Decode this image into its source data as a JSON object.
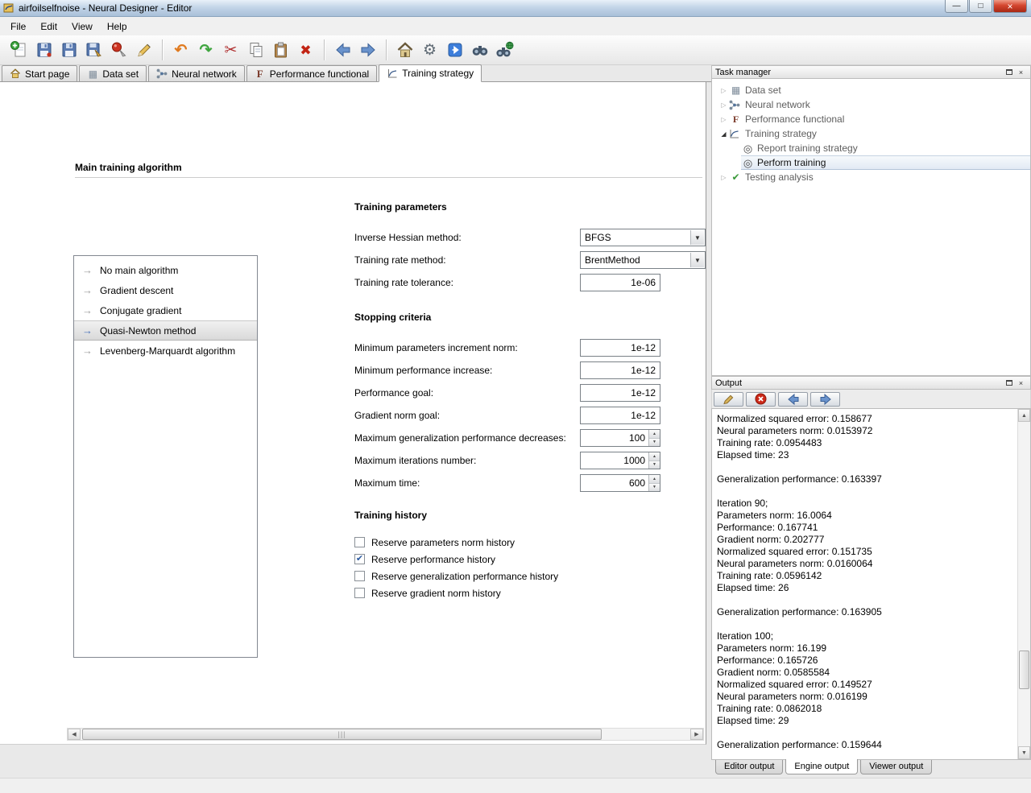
{
  "window": {
    "title": "airfoilselfnoise - Neural Designer - Editor"
  },
  "menu": {
    "items": [
      "File",
      "Edit",
      "View",
      "Help"
    ]
  },
  "icons": {
    "minimize": "—",
    "maximize": "□",
    "close": "×",
    "undo": "↶",
    "redo": "↷",
    "cut": "✂",
    "delete": "✖",
    "home": "⌂",
    "gear": "⚙",
    "item_arrow": "→",
    "check": "✔",
    "collapsed": "▷",
    "expanded": "◢",
    "bullseye": "◎",
    "grid": "▦",
    "letter_f": "F",
    "combo_arrow": "▼",
    "spin_up": "▲",
    "spin_down": "▼",
    "left": "◀",
    "right": "▶",
    "up": "▲",
    "down": "▼",
    "grip": "|||"
  },
  "toolbar": {
    "buttons": [
      "new",
      "open",
      "save",
      "save-as",
      "print",
      "edit",
      "undo",
      "redo",
      "cut",
      "copy",
      "paste",
      "delete",
      "back",
      "forward",
      "home",
      "settings",
      "run",
      "search",
      "find"
    ]
  },
  "tabs": {
    "items": [
      {
        "label": "Start page",
        "active": false
      },
      {
        "label": "Data set",
        "active": false
      },
      {
        "label": "Neural network",
        "active": false
      },
      {
        "label": "Performance functional",
        "active": false
      },
      {
        "label": "Training strategy",
        "active": true
      }
    ]
  },
  "main": {
    "title": "Main training algorithm",
    "algorithms": {
      "items": [
        "No main algorithm",
        "Gradient descent",
        "Conjugate gradient",
        "Quasi-Newton method",
        "Levenberg-Marquardt algorithm"
      ],
      "selected_index": 3
    },
    "training_parameters": {
      "title": "Training parameters",
      "rows": [
        {
          "label": "Inverse Hessian method:",
          "value": "BFGS",
          "type": "combo"
        },
        {
          "label": "Training rate method:",
          "value": "BrentMethod",
          "type": "combo"
        },
        {
          "label": "Training rate tolerance:",
          "value": "1e-06",
          "type": "text"
        }
      ]
    },
    "stopping_criteria": {
      "title": "Stopping criteria",
      "rows": [
        {
          "label": "Minimum parameters increment norm:",
          "value": "1e-12",
          "type": "text"
        },
        {
          "label": "Minimum performance increase:",
          "value": "1e-12",
          "type": "text"
        },
        {
          "label": "Performance goal:",
          "value": "1e-12",
          "type": "text"
        },
        {
          "label": "Gradient norm goal:",
          "value": "1e-12",
          "type": "text"
        },
        {
          "label": "Maximum generalization performance decreases:",
          "value": "100",
          "type": "spin"
        },
        {
          "label": "Maximum iterations number:",
          "value": "1000",
          "type": "spin"
        },
        {
          "label": "Maximum time:",
          "value": "600",
          "type": "spin"
        }
      ]
    },
    "training_history": {
      "title": "Training history",
      "items": [
        {
          "label": "Reserve parameters norm history",
          "checked": false
        },
        {
          "label": "Reserve performance history",
          "checked": true
        },
        {
          "label": "Reserve generalization performance history",
          "checked": false
        },
        {
          "label": "Reserve gradient norm history",
          "checked": false
        }
      ]
    }
  },
  "task_manager": {
    "title": "Task manager",
    "items": [
      {
        "label": "Data set",
        "level": 0,
        "state": "collapsed"
      },
      {
        "label": "Neural network",
        "level": 0,
        "state": "collapsed"
      },
      {
        "label": "Performance functional",
        "level": 0,
        "state": "collapsed"
      },
      {
        "label": "Training strategy",
        "level": 0,
        "state": "expanded"
      },
      {
        "label": "Report training strategy",
        "level": 1,
        "selected": false
      },
      {
        "label": "Perform training",
        "level": 1,
        "selected": true
      },
      {
        "label": "Testing analysis",
        "level": 0,
        "state": "collapsed"
      }
    ]
  },
  "output": {
    "title": "Output",
    "lines": [
      "Normalized squared error: 0.158677",
      "Neural parameters norm: 0.0153972",
      "Training rate: 0.0954483",
      "Elapsed time: 23",
      "",
      "Generalization performance: 0.163397",
      "",
      "Iteration 90;",
      "Parameters norm: 16.0064",
      "Performance: 0.167741",
      "Gradient norm: 0.202777",
      "Normalized squared error: 0.151735",
      "Neural parameters norm: 0.0160064",
      "Training rate: 0.0596142",
      "Elapsed time: 26",
      "",
      "Generalization performance: 0.163905",
      "",
      "Iteration 100;",
      "Parameters norm: 16.199",
      "Performance: 0.165726",
      "Gradient norm: 0.0585584",
      "Normalized squared error: 0.149527",
      "Neural parameters norm: 0.016199",
      "Training rate: 0.0862018",
      "Elapsed time: 29",
      "",
      "Generalization performance: 0.159644"
    ],
    "tabs": [
      "Editor output",
      "Engine output",
      "Viewer output"
    ]
  }
}
